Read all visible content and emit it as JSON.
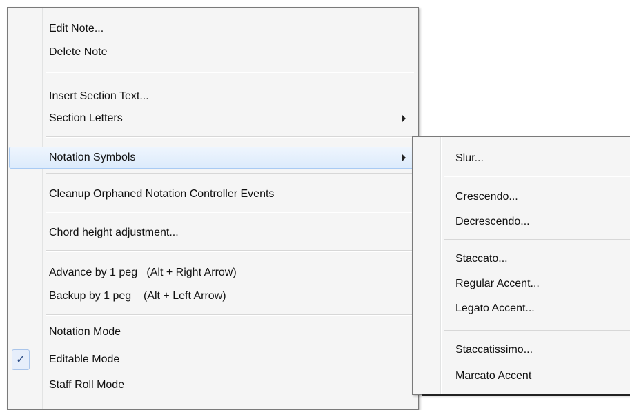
{
  "main_menu": {
    "edit_note": "Edit Note...",
    "delete_note": "Delete Note",
    "insert_section_text": "Insert Section Text...",
    "section_letters": "Section Letters",
    "notation_symbols": "Notation Symbols",
    "cleanup": "Cleanup Orphaned Notation Controller Events",
    "chord_height": "Chord height adjustment...",
    "advance": "Advance by 1 peg   (Alt + Right Arrow)",
    "backup": "Backup by 1 peg    (Alt + Left Arrow)",
    "notation_mode": "Notation Mode",
    "editable_mode": "Editable Mode",
    "staff_roll_mode": "Staff Roll Mode",
    "checked_item": "Editable Mode",
    "check_glyph": "✓"
  },
  "submenu": {
    "slur": "Slur...",
    "crescendo": "Crescendo...",
    "decrescendo": "Decrescendo...",
    "staccato": "Staccato...",
    "regular_accent": "Regular Accent...",
    "legato_accent": "Legato Accent...",
    "staccatissimo": "Staccatissimo...",
    "marcato_accent": "Marcato Accent"
  },
  "colors": {
    "menu_bg": "#f5f5f5",
    "highlight": "#dcebfc",
    "highlight_border": "#a9cbf3"
  },
  "icons": {
    "submenu_arrow": "triangle-right",
    "checkmark": "check-mark"
  }
}
